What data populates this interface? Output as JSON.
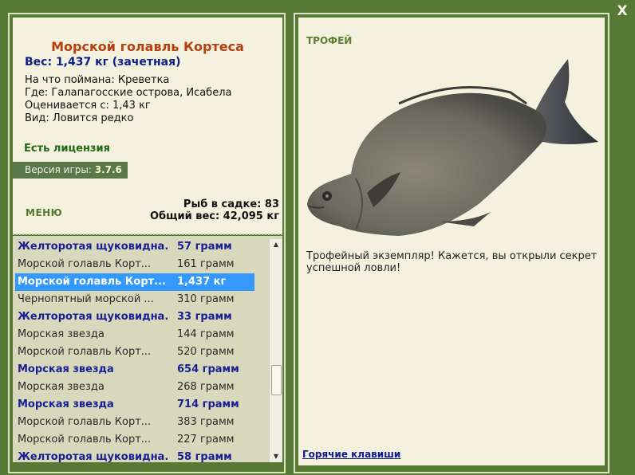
{
  "close_label": "X",
  "fish": {
    "title": "Морской голавль Кортеса",
    "weight": "Вес: 1,437 кг (зачетная)",
    "caught_on": "На что поймана: Креветка",
    "location": "Где: Галапагосские острова, Исабела",
    "valued": "Оценивается с: 1,43 кг",
    "rarity": "Вид: Ловится редко"
  },
  "license": "Есть лицензия",
  "version": {
    "label": "Версия игры:",
    "value": "3.7.6"
  },
  "menu_label": "МЕНЮ",
  "stats": {
    "count": "Рыб в садке: 83",
    "total": "Общий вес: 42,095 кг"
  },
  "catch_list": [
    {
      "name": "Желторотая щуковидна...",
      "weight": "57 грамм",
      "style": "bold"
    },
    {
      "name": "Морской голавль Корт...",
      "weight": "161 грамм",
      "style": "plain"
    },
    {
      "name": "Морской голавль Корт...",
      "weight": "1,437 кг",
      "style": "sel"
    },
    {
      "name": "Чернопятный морской ...",
      "weight": "310 грамм",
      "style": "plain"
    },
    {
      "name": "Желторотая щуковидна...",
      "weight": "33 грамм",
      "style": "bold"
    },
    {
      "name": "Морская звезда",
      "weight": "144 грамм",
      "style": "plain"
    },
    {
      "name": "Морской голавль Корт...",
      "weight": "520 грамм",
      "style": "plain"
    },
    {
      "name": "Морская звезда",
      "weight": "654 грамм",
      "style": "bold"
    },
    {
      "name": "Морская звезда",
      "weight": "268 грамм",
      "style": "plain"
    },
    {
      "name": "Морская звезда",
      "weight": "714 грамм",
      "style": "bold"
    },
    {
      "name": "Морской голавль Корт...",
      "weight": "383 грамм",
      "style": "plain"
    },
    {
      "name": "Морской голавль Корт...",
      "weight": "227 грамм",
      "style": "plain"
    },
    {
      "name": "Желторотая щуковидна...",
      "weight": "58 грамм",
      "style": "bold"
    }
  ],
  "trophy": {
    "label": "ТРОФЕЙ",
    "description": "Трофейный экземпляр! Кажется, вы открыли секрет успешной ловли!"
  },
  "hotkeys_label": "Горячие клавиши"
}
